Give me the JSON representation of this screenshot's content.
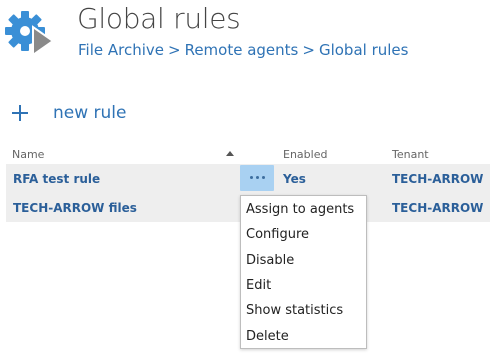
{
  "header": {
    "title": "Global rules",
    "breadcrumb": [
      "File Archive",
      "Remote agents",
      "Global rules"
    ],
    "breadcrumb_separator": ">",
    "icon": "gear-play-icon"
  },
  "toolbar": {
    "new_rule_label": "new rule",
    "new_rule_icon": "plus-icon"
  },
  "table": {
    "columns": [
      "Name",
      "Enabled",
      "Tenant"
    ],
    "sort": {
      "column": "Name",
      "direction": "ascending"
    },
    "rows": [
      {
        "name": "RFA test rule",
        "enabled": "Yes",
        "tenant": "TECH-ARROW"
      },
      {
        "name": "TECH-ARROW files",
        "enabled": "",
        "tenant": "TECH-ARROW"
      }
    ],
    "actions_icon": "more-icon"
  },
  "context_menu": {
    "items": [
      "Assign to agents",
      "Configure",
      "Disable",
      "Edit",
      "Show statistics",
      "Delete"
    ]
  },
  "colors": {
    "accent": "#2f73b5",
    "row_bg": "#eeeeee",
    "highlight": "#a9d1f2"
  }
}
